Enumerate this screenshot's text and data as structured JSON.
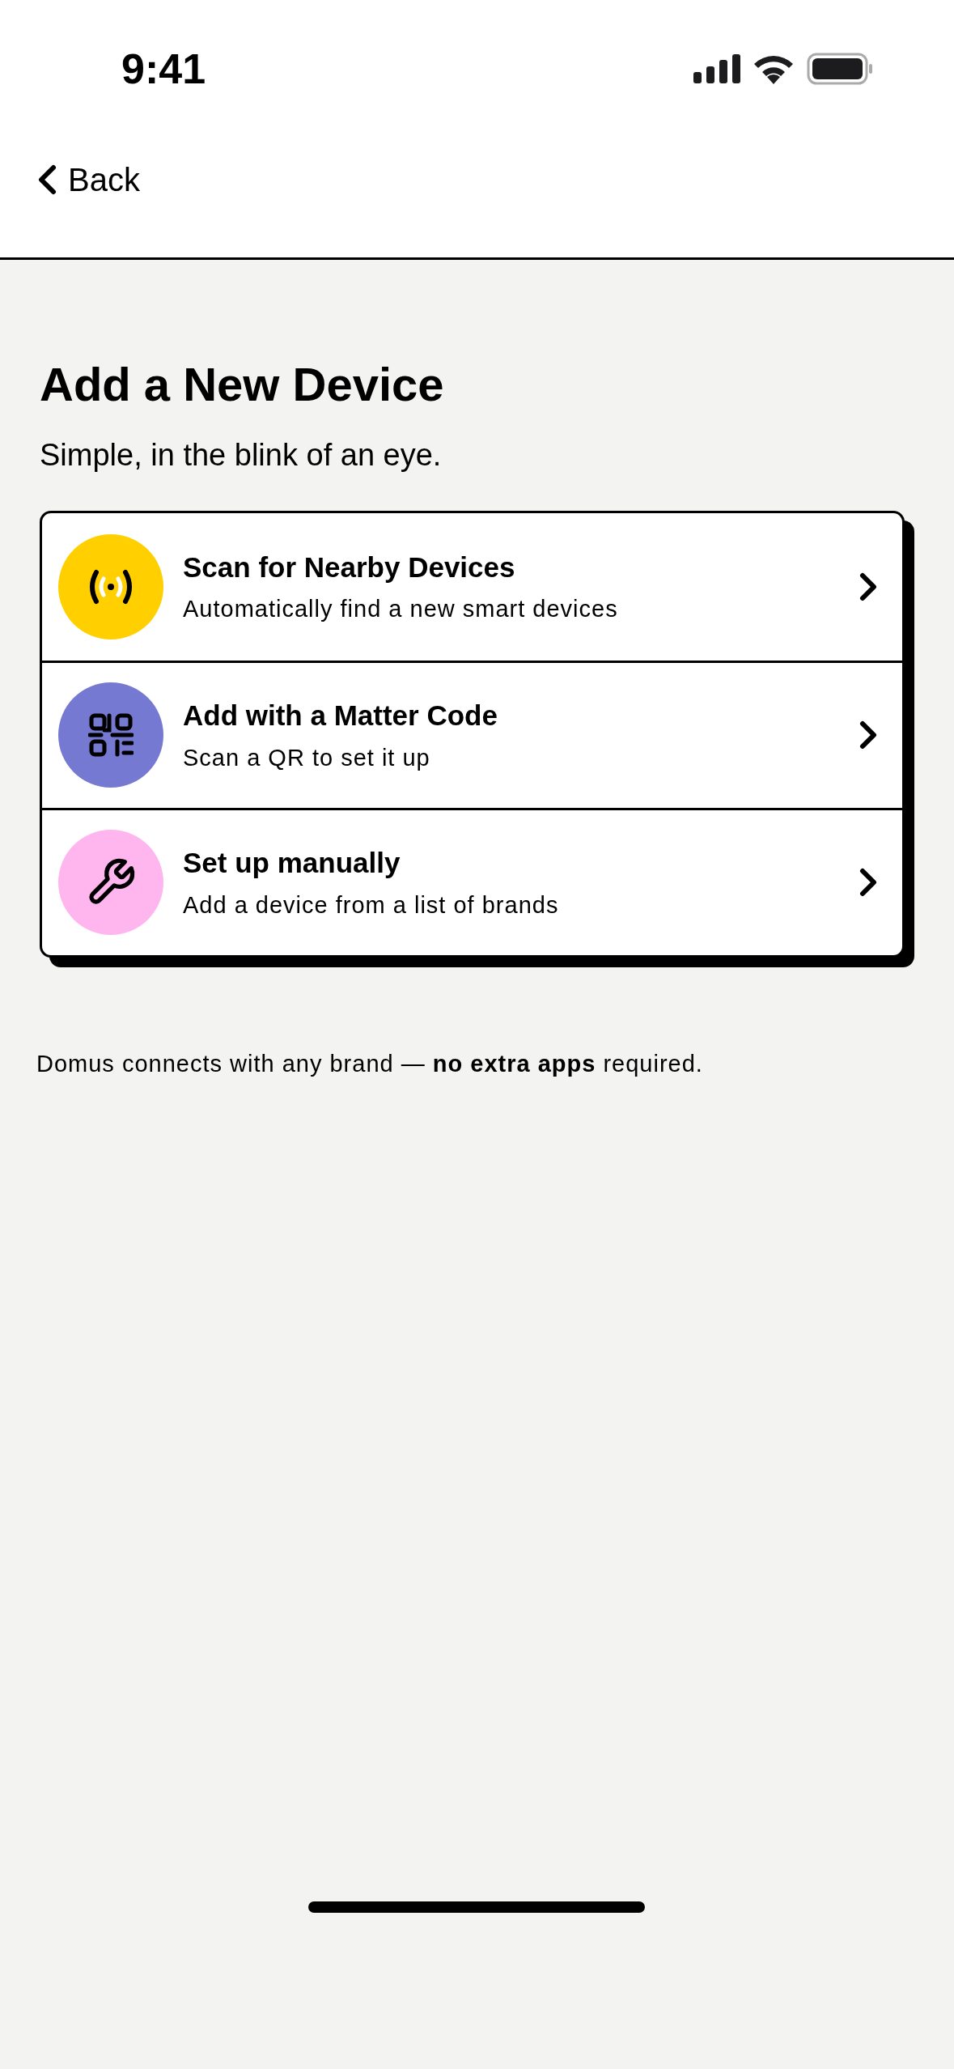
{
  "status_bar": {
    "time": "9:41"
  },
  "nav": {
    "back": "Back"
  },
  "title": "Add a New Device",
  "subtitle": "Simple, in the blink of an eye.",
  "options": [
    {
      "kind": "scan",
      "color": "#ffcf00",
      "title": "Scan for Nearby Devices",
      "description": "Automatically find a new smart devices"
    },
    {
      "kind": "qr",
      "color": "#7579d1",
      "title": "Add with a Matter Code",
      "description": "Scan a QR to set it up"
    },
    {
      "kind": "manual",
      "color": "#ffb6ef",
      "title": "Set up manually",
      "description": "Add a device from a list of brands"
    }
  ],
  "footer": "Domus connects with any brand — **no extra apps** required."
}
